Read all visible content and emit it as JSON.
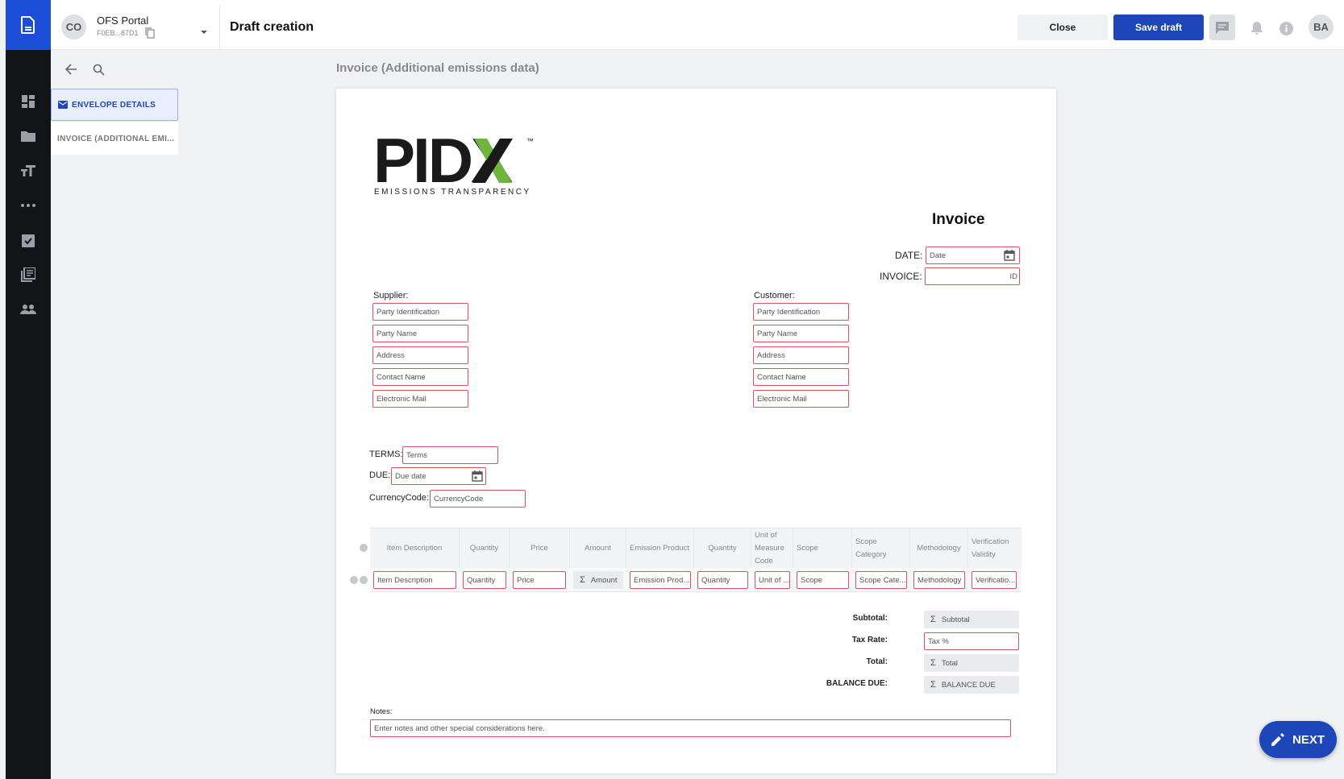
{
  "topbar": {
    "avatar_initials": "CO",
    "portal_name": "OFS Portal",
    "portal_id": "F0EB...87D1",
    "page_title": "Draft creation",
    "close_label": "Close",
    "save_label": "Save draft",
    "user_initials": "BA"
  },
  "sidebar": {
    "items": [
      {
        "label": "ENVELOPE DETAILS"
      },
      {
        "label": "INVOICE (ADDITIONAL EMI..."
      }
    ]
  },
  "document": {
    "heading": "Invoice (Additional emissions data)",
    "logo_main": "PIDX",
    "logo_tm": "™",
    "logo_sub": "EMISSIONS TRANSPARENCY",
    "title": "Invoice",
    "date_label": "DATE:",
    "date_placeholder": "Date",
    "invoice_label": "INVOICE:",
    "invoice_placeholder": "ID",
    "supplier_label": "Supplier:",
    "customer_label": "Customer:",
    "party_fields": [
      "Party Identification",
      "Party Name",
      "Address",
      "Contact Name",
      "Electronic Mail"
    ],
    "terms_label": "TERMS:",
    "terms_placeholder": "Terms",
    "due_label": "DUE:",
    "due_placeholder": "Due date",
    "currency_label": "CurrencyCode:",
    "currency_placeholder": "CurrencyCode",
    "table_headers": [
      "Item Description",
      "Quantity",
      "Price",
      "Amount",
      "Emission Product",
      "Quantity",
      "Unit of Measure Code",
      "Scope",
      "Scope Category",
      "Methodology",
      "Verification Validity"
    ],
    "table_row": [
      "Item Description",
      "Quantity",
      "Price",
      "Amount",
      "Emission Prod...",
      "Quantity",
      "Unit of ...",
      "Scope",
      "Scope Cate...",
      "Methodology",
      "Verificatio..."
    ],
    "subtotal_label": "Subtotal:",
    "subtotal_placeholder": "Subtotal",
    "tax_label": "Tax Rate:",
    "tax_placeholder": "Tax %",
    "total_label": "Total:",
    "total_placeholder": "Total",
    "balance_label": "BALANCE DUE:",
    "balance_placeholder": "BALANCE DUE",
    "notes_label": "Notes:",
    "notes_placeholder": "Enter notes and other special considerations here.",
    "sigma": "Σ"
  },
  "next_label": "NEXT",
  "colors": {
    "rail": "#121417",
    "brand": "#1d46b8",
    "field_border": "#d9535f",
    "logo_green": "#6fb43f"
  },
  "icons": [
    "document-icon",
    "dashboard-icon",
    "folder-icon",
    "text-size-icon",
    "more-icon",
    "task-icon",
    "library-icon",
    "people-icon",
    "copy-icon",
    "chevron-down-icon",
    "chat-icon",
    "bell-icon",
    "info-icon",
    "back-arrow-icon",
    "search-icon",
    "mail-icon",
    "calendar-icon",
    "edit-icon"
  ]
}
